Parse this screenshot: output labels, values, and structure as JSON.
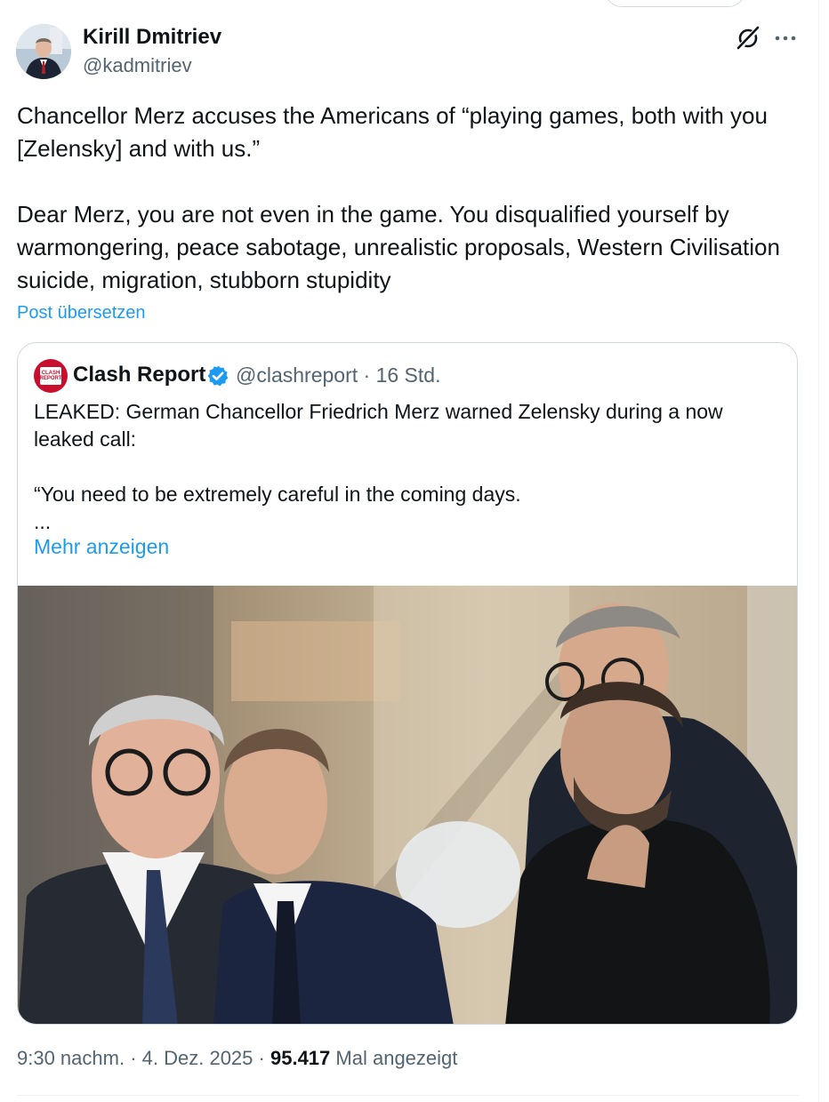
{
  "author": {
    "name": "Kirill Dmitriev",
    "handle": "@kadmitriev"
  },
  "tweet": {
    "paragraphs": [
      "Chancellor Merz accuses the Americans of “playing games, both with you [Zelensky] and with us.”",
      "Dear Merz, you are not even in the game. You disqualified yourself by warmongering, peace sabotage, unrealistic proposals, Western Civilisation suicide, migration, stubborn stupidity"
    ],
    "translate_label": "Post übersetzen"
  },
  "quote": {
    "name": "Clash Report",
    "handle": "@clashreport",
    "separator": "·",
    "time": "16 Std.",
    "avatar_text": "CLASH REPORT",
    "lines": [
      "LEAKED: German Chancellor Friedrich Merz warned Zelensky during a now leaked call:",
      "“You need to be extremely careful in the coming days.",
      "..."
    ],
    "show_more": "Mehr anzeigen"
  },
  "meta": {
    "time": "9:30 nachm.",
    "sep": "·",
    "date": "4. Dez. 2025",
    "views": "95.417",
    "views_label": "Mal angezeigt"
  },
  "icons": {
    "grok": "grok-icon",
    "more": "more-icon",
    "verified": "verified-badge-icon"
  },
  "colors": {
    "link": "#1d9bf0",
    "secondary_text": "#536471",
    "verified": "#1d9bf0",
    "clash_red": "#c8102e"
  }
}
